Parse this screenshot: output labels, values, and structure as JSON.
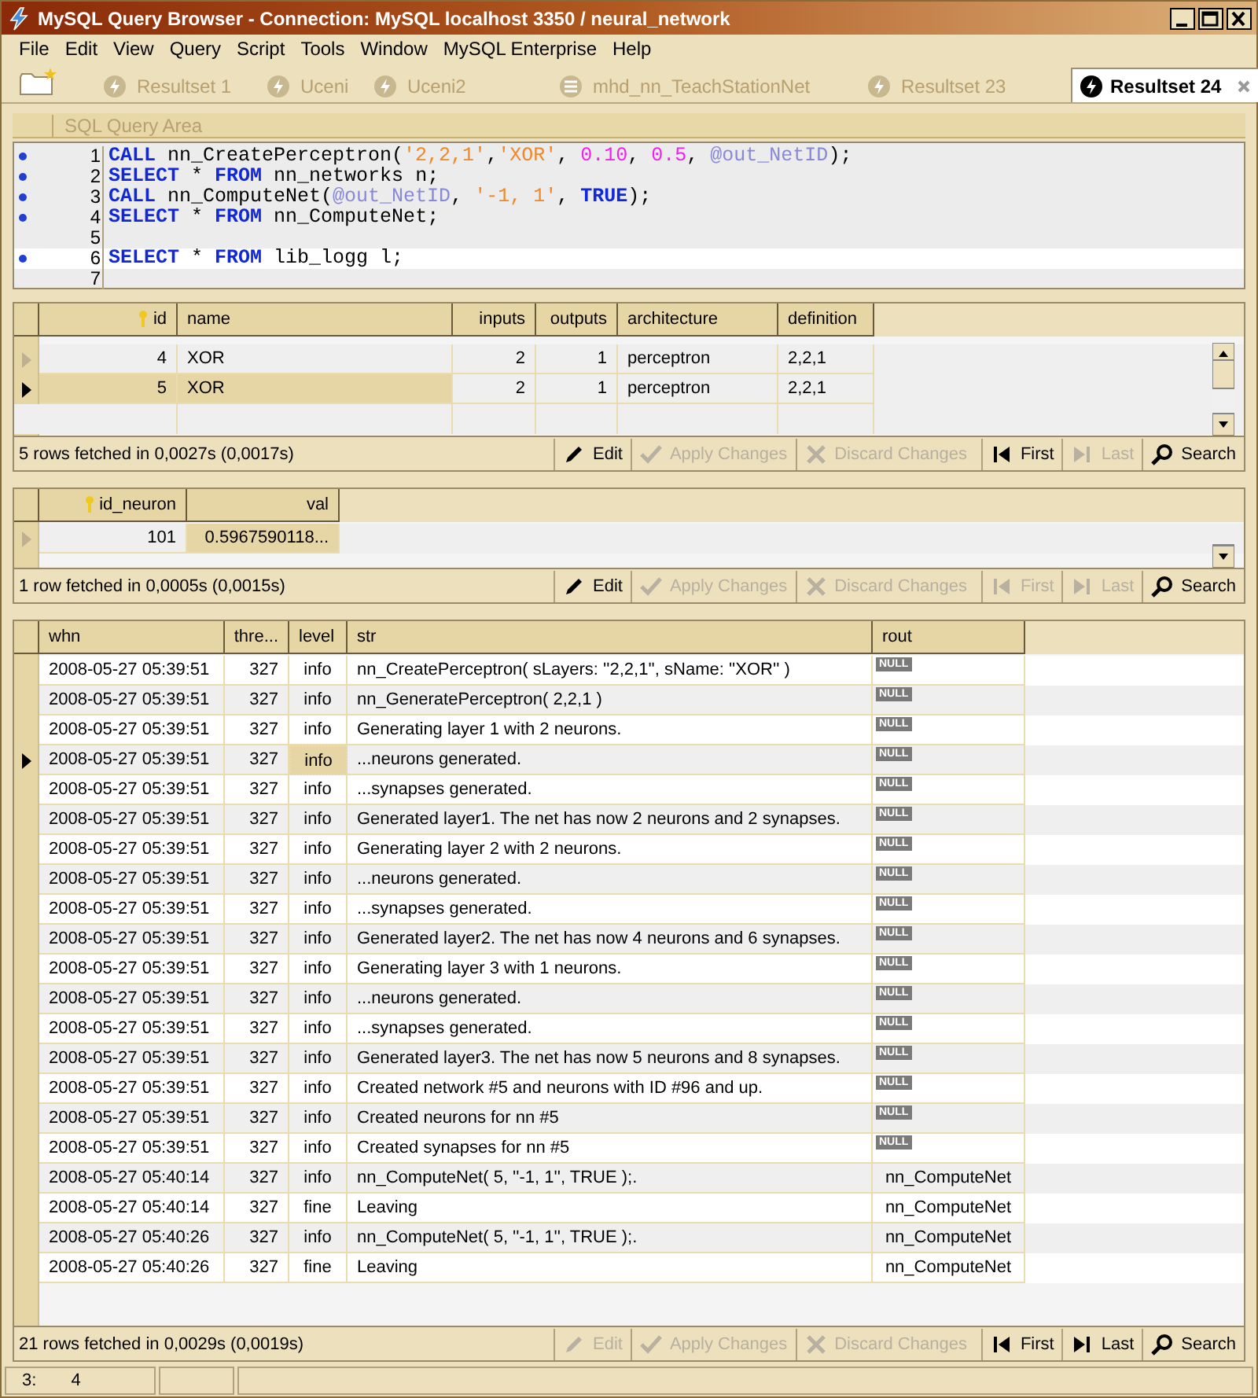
{
  "window": {
    "title": "MySQL Query Browser - Connection: MySQL localhost 3350 / neural_network"
  },
  "menu": [
    {
      "label": "File"
    },
    {
      "label": "Edit"
    },
    {
      "label": "View"
    },
    {
      "label": "Query"
    },
    {
      "label": "Script"
    },
    {
      "label": "Tools"
    },
    {
      "label": "Window"
    },
    {
      "label": "MySQL Enterprise"
    },
    {
      "label": "Help"
    }
  ],
  "tabs": [
    {
      "label": "Resultset 1",
      "kind": "query",
      "selected": false
    },
    {
      "label": "Uceni",
      "kind": "query",
      "selected": false
    },
    {
      "label": "Uceni2",
      "kind": "query",
      "selected": false
    },
    {
      "label": "mhd_nn_TeachStationNet",
      "kind": "script",
      "selected": false
    },
    {
      "label": "Resultset 23",
      "kind": "query",
      "selected": false
    },
    {
      "label": "Resultset 24",
      "kind": "query",
      "selected": true
    }
  ],
  "sql_area": {
    "label": "SQL Query Area",
    "lines": [
      {
        "number": "1",
        "marked": true,
        "current": false,
        "tokens": [
          {
            "text": "CALL",
            "kind": "keyword"
          },
          {
            "text": " nn_CreatePerceptron(",
            "kind": "plain"
          },
          {
            "text": "'2,2,1'",
            "kind": "string"
          },
          {
            "text": ",",
            "kind": "plain"
          },
          {
            "text": "'XOR'",
            "kind": "string"
          },
          {
            "text": ", ",
            "kind": "plain"
          },
          {
            "text": "0.10",
            "kind": "number"
          },
          {
            "text": ", ",
            "kind": "plain"
          },
          {
            "text": "0.5",
            "kind": "number"
          },
          {
            "text": ", ",
            "kind": "plain"
          },
          {
            "text": "@out_NetID",
            "kind": "variable"
          },
          {
            "text": ");",
            "kind": "plain"
          }
        ]
      },
      {
        "number": "2",
        "marked": true,
        "current": false,
        "tokens": [
          {
            "text": "SELECT",
            "kind": "keyword"
          },
          {
            "text": " * ",
            "kind": "plain"
          },
          {
            "text": "FROM",
            "kind": "keyword"
          },
          {
            "text": " nn_networks n;",
            "kind": "plain"
          }
        ]
      },
      {
        "number": "3",
        "marked": true,
        "current": false,
        "tokens": [
          {
            "text": "CALL",
            "kind": "keyword"
          },
          {
            "text": " nn_ComputeNet(",
            "kind": "plain"
          },
          {
            "text": "@out_NetID",
            "kind": "variable"
          },
          {
            "text": ", ",
            "kind": "plain"
          },
          {
            "text": "'-1, 1'",
            "kind": "string"
          },
          {
            "text": ", ",
            "kind": "plain"
          },
          {
            "text": "TRUE",
            "kind": "keyword"
          },
          {
            "text": ");",
            "kind": "plain"
          }
        ]
      },
      {
        "number": "4",
        "marked": true,
        "current": false,
        "tokens": [
          {
            "text": "SELECT",
            "kind": "keyword"
          },
          {
            "text": " * ",
            "kind": "plain"
          },
          {
            "text": "FROM",
            "kind": "keyword"
          },
          {
            "text": " nn_ComputeNet;",
            "kind": "plain"
          }
        ]
      },
      {
        "number": "5",
        "marked": false,
        "current": false
      },
      {
        "number": "6",
        "marked": true,
        "current": true,
        "tokens": [
          {
            "text": "SELECT",
            "kind": "keyword"
          },
          {
            "text": " * ",
            "kind": "plain"
          },
          {
            "text": "FROM",
            "kind": "keyword"
          },
          {
            "text": " lib_logg l;",
            "kind": "plain"
          }
        ]
      },
      {
        "number": "7",
        "marked": false,
        "current": false
      }
    ]
  },
  "result_grids": [
    {
      "columns": [
        {
          "label": "id",
          "key": true
        },
        {
          "label": "name",
          "key": false
        },
        {
          "label": "inputs",
          "key": false
        },
        {
          "label": "outputs",
          "key": false
        },
        {
          "label": "architecture",
          "key": false
        },
        {
          "label": "definition",
          "key": false
        }
      ],
      "rows": [
        {
          "selected": false,
          "cells": [
            "4",
            "XOR",
            "2",
            "1",
            "perceptron",
            "2,2,1"
          ]
        },
        {
          "selected": true,
          "cells": [
            {
              "text": "5",
              "focused": true
            },
            {
              "text": "XOR",
              "focused": true
            },
            "2",
            "1",
            "perceptron",
            "2,2,1"
          ]
        }
      ],
      "status": "5 rows fetched in 0,0027s (0,0017s)",
      "buttons": [
        {
          "label": "Edit",
          "kind": "edit",
          "disabled": false
        },
        {
          "label": "Apply Changes",
          "kind": "apply",
          "disabled": true
        },
        {
          "label": "Discard Changes",
          "kind": "discard",
          "disabled": true
        },
        {
          "label": "First",
          "kind": "first",
          "disabled": false
        },
        {
          "label": "Last",
          "kind": "last",
          "disabled": true
        },
        {
          "label": "Search",
          "kind": "search",
          "disabled": false
        }
      ]
    },
    {
      "columns": [
        {
          "label": "id_neuron",
          "key": true
        },
        {
          "label": "val",
          "key": false
        }
      ],
      "rows": [
        {
          "selected": false,
          "cells": [
            "101",
            {
              "text": "0.5967590118...",
              "focused": true
            }
          ]
        }
      ],
      "status": "1 row fetched in 0,0005s (0,0015s)",
      "buttons": [
        {
          "label": "Edit",
          "kind": "edit",
          "disabled": false
        },
        {
          "label": "Apply Changes",
          "kind": "apply",
          "disabled": true
        },
        {
          "label": "Discard Changes",
          "kind": "discard",
          "disabled": true
        },
        {
          "label": "First",
          "kind": "first",
          "disabled": true
        },
        {
          "label": "Last",
          "kind": "last",
          "disabled": true
        },
        {
          "label": "Search",
          "kind": "search",
          "disabled": false
        }
      ]
    },
    {
      "columns": [
        {
          "label": "whn",
          "key": false
        },
        {
          "label": "thre...",
          "key": false
        },
        {
          "label": "level",
          "key": false
        },
        {
          "label": "str",
          "key": false
        },
        {
          "label": "rout",
          "key": false
        }
      ],
      "rows": [
        {
          "selected": false,
          "cells": [
            "2008-05-27 05:39:51",
            "327",
            "info",
            "nn_CreatePerceptron( sLayers: ''2,2,1'', sName: ''XOR'' )",
            {
              "text": "NULL",
              "kind": "null"
            }
          ]
        },
        {
          "selected": false,
          "cells": [
            "2008-05-27 05:39:51",
            "327",
            "info",
            "nn_GeneratePerceptron( 2,2,1 )",
            {
              "text": "NULL",
              "kind": "null"
            }
          ]
        },
        {
          "selected": false,
          "cells": [
            "2008-05-27 05:39:51",
            "327",
            "info",
            "Generating layer 1 with 2 neurons.",
            {
              "text": "NULL",
              "kind": "null"
            }
          ]
        },
        {
          "selected": true,
          "cells": [
            "2008-05-27 05:39:51",
            "327",
            {
              "text": "info",
              "focused": true
            },
            "...neurons generated.",
            {
              "text": "NULL",
              "kind": "null"
            }
          ]
        },
        {
          "selected": false,
          "cells": [
            "2008-05-27 05:39:51",
            "327",
            "info",
            "...synapses generated.",
            {
              "text": "NULL",
              "kind": "null"
            }
          ]
        },
        {
          "selected": false,
          "cells": [
            "2008-05-27 05:39:51",
            "327",
            "info",
            "Generated layer1. The net has now 2 neurons and 2 synapses.",
            {
              "text": "NULL",
              "kind": "null"
            }
          ]
        },
        {
          "selected": false,
          "cells": [
            "2008-05-27 05:39:51",
            "327",
            "info",
            "Generating layer 2 with 2 neurons.",
            {
              "text": "NULL",
              "kind": "null"
            }
          ]
        },
        {
          "selected": false,
          "cells": [
            "2008-05-27 05:39:51",
            "327",
            "info",
            "...neurons generated.",
            {
              "text": "NULL",
              "kind": "null"
            }
          ]
        },
        {
          "selected": false,
          "cells": [
            "2008-05-27 05:39:51",
            "327",
            "info",
            "...synapses generated.",
            {
              "text": "NULL",
              "kind": "null"
            }
          ]
        },
        {
          "selected": false,
          "cells": [
            "2008-05-27 05:39:51",
            "327",
            "info",
            "Generated layer2. The net has now 4 neurons and 6 synapses.",
            {
              "text": "NULL",
              "kind": "null"
            }
          ]
        },
        {
          "selected": false,
          "cells": [
            "2008-05-27 05:39:51",
            "327",
            "info",
            "Generating layer 3 with 1 neurons.",
            {
              "text": "NULL",
              "kind": "null"
            }
          ]
        },
        {
          "selected": false,
          "cells": [
            "2008-05-27 05:39:51",
            "327",
            "info",
            "...neurons generated.",
            {
              "text": "NULL",
              "kind": "null"
            }
          ]
        },
        {
          "selected": false,
          "cells": [
            "2008-05-27 05:39:51",
            "327",
            "info",
            "...synapses generated.",
            {
              "text": "NULL",
              "kind": "null"
            }
          ]
        },
        {
          "selected": false,
          "cells": [
            "2008-05-27 05:39:51",
            "327",
            "info",
            "Generated layer3. The net has now 5 neurons and 8 synapses.",
            {
              "text": "NULL",
              "kind": "null"
            }
          ]
        },
        {
          "selected": false,
          "cells": [
            "2008-05-27 05:39:51",
            "327",
            "info",
            "Created network #5 and neurons with ID #96 and up.",
            {
              "text": "NULL",
              "kind": "null"
            }
          ]
        },
        {
          "selected": false,
          "cells": [
            "2008-05-27 05:39:51",
            "327",
            "info",
            "Created neurons for nn #5",
            {
              "text": "NULL",
              "kind": "null"
            }
          ]
        },
        {
          "selected": false,
          "cells": [
            "2008-05-27 05:39:51",
            "327",
            "info",
            "Created synapses for nn #5",
            {
              "text": "NULL",
              "kind": "null"
            }
          ]
        },
        {
          "selected": false,
          "cells": [
            "2008-05-27 05:40:14",
            "327",
            "info",
            "nn_ComputeNet( 5, ''-1, 1'', TRUE );.",
            "nn_ComputeNet"
          ]
        },
        {
          "selected": false,
          "cells": [
            "2008-05-27 05:40:14",
            "327",
            "fine",
            "Leaving",
            "nn_ComputeNet"
          ]
        },
        {
          "selected": false,
          "cells": [
            "2008-05-27 05:40:26",
            "327",
            "info",
            "nn_ComputeNet( 5, ''-1, 1'', TRUE );.",
            "nn_ComputeNet"
          ]
        },
        {
          "selected": false,
          "cells": [
            "2008-05-27 05:40:26",
            "327",
            "fine",
            "Leaving",
            "nn_ComputeNet"
          ]
        }
      ],
      "status": "21 rows fetched in 0,0029s (0,0019s)",
      "buttons": [
        {
          "label": "Edit",
          "kind": "edit",
          "disabled": true
        },
        {
          "label": "Apply Changes",
          "kind": "apply",
          "disabled": true
        },
        {
          "label": "Discard Changes",
          "kind": "discard",
          "disabled": true
        },
        {
          "label": "First",
          "kind": "first",
          "disabled": false
        },
        {
          "label": "Last",
          "kind": "last",
          "disabled": false
        },
        {
          "label": "Search",
          "kind": "search",
          "disabled": false
        }
      ]
    }
  ],
  "status_bar": {
    "line": "3:",
    "column": "4"
  }
}
